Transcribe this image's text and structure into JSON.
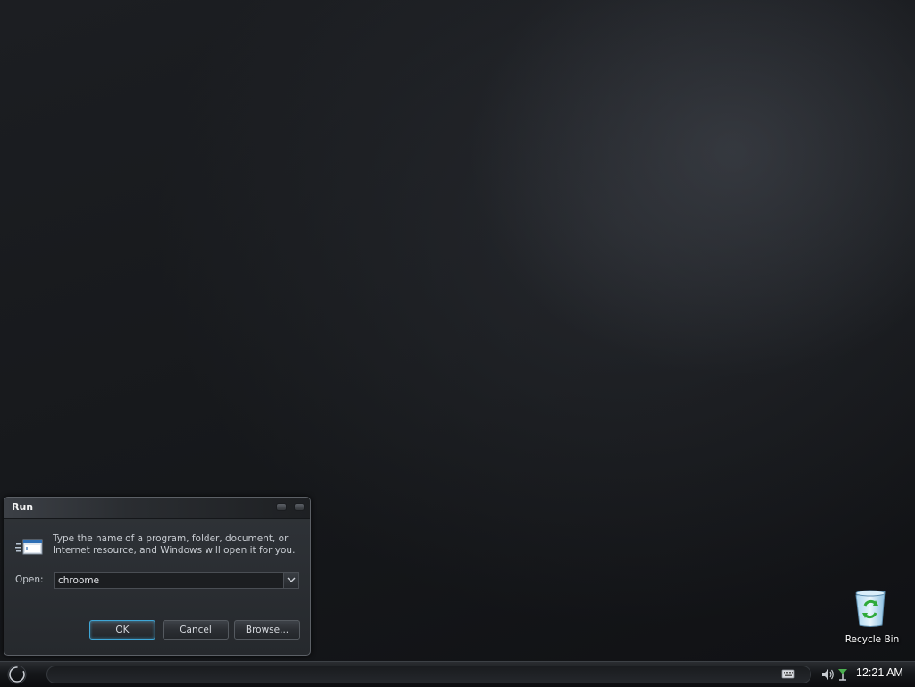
{
  "run_dialog": {
    "title": "Run",
    "description": "Type the name of a program, folder, document, or Internet resource, and Windows will open it for you.",
    "open_label": "Open:",
    "open_value": "chroome",
    "ok_label": "OK",
    "cancel_label": "Cancel",
    "browse_label": "Browse...",
    "icon": "run-icon"
  },
  "desktop": {
    "icons": [
      {
        "label": "Recycle Bin",
        "icon": "recycle-bin-icon"
      }
    ]
  },
  "taskbar": {
    "start_icon": "start-orb-icon",
    "tray_icons": [
      "keyboard-icon",
      "volume-icon",
      "network-icon"
    ],
    "clock": "12:21 AM"
  },
  "colors": {
    "accent_focus": "#3fa6d6",
    "dialog_bg": "#2b2e33",
    "desktop_bg": "#16181b"
  }
}
